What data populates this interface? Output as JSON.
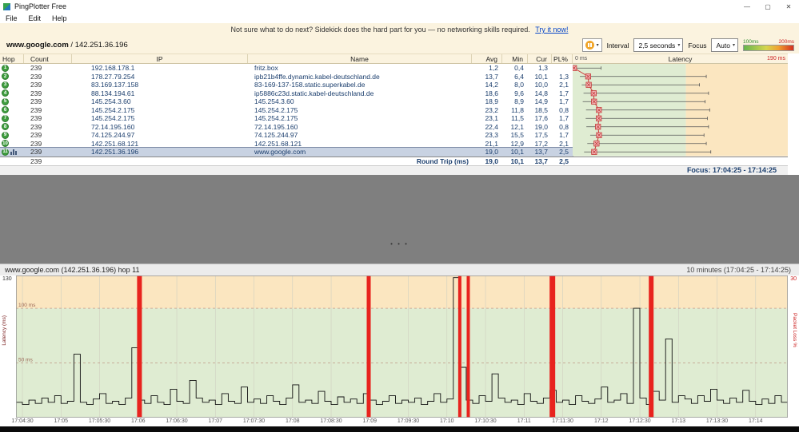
{
  "window": {
    "title": "PingPlotter Free"
  },
  "icons": {
    "minimize": "—",
    "maximize": "▢",
    "close": "✕",
    "dropdown": "▾",
    "splitter": "• • •"
  },
  "menu": {
    "items": [
      "File",
      "Edit",
      "Help"
    ]
  },
  "notice": {
    "text": "Not sure what to do next? Sidekick does the hard part for you — no networking skills required.",
    "link": "Try it now!"
  },
  "target": {
    "host": "www.google.com",
    "separator": "/",
    "ip": "142.251.36.196"
  },
  "toolbar": {
    "interval_label": "Interval",
    "interval_value": "2,5 seconds",
    "focus_label": "Focus",
    "focus_value": "Auto",
    "legend_low": "100ms",
    "legend_high": "200ms"
  },
  "table": {
    "columns": [
      "Hop",
      "Count",
      "IP",
      "Name",
      "Avg",
      "Min",
      "Cur",
      "PL%"
    ],
    "latency_title": "Latency",
    "scale_min": "0 ms",
    "scale_max": "190 ms",
    "scale_max_ms": 190,
    "green_threshold_ms": 100,
    "rows": [
      {
        "hop": "1",
        "count": "239",
        "ip": "192.168.178.1",
        "name": "fritz.box",
        "avg": "1,2",
        "min": "0,4",
        "cur": "1,3",
        "pl": "",
        "selected": false,
        "g": {
          "min": 0.4,
          "avg": 1.2,
          "max": 25
        }
      },
      {
        "hop": "2",
        "count": "239",
        "ip": "178.27.79.254",
        "name": "ipb21b4ffe.dynamic.kabel-deutschland.de",
        "avg": "13,7",
        "min": "6,4",
        "cur": "10,1",
        "pl": "1,3",
        "selected": false,
        "g": {
          "min": 6.4,
          "avg": 13.7,
          "max": 118
        }
      },
      {
        "hop": "3",
        "count": "239",
        "ip": "83.169.137.158",
        "name": "83-169-137-158.static.superkabel.de",
        "avg": "14,2",
        "min": "8,0",
        "cur": "10,0",
        "pl": "2,1",
        "selected": false,
        "g": {
          "min": 8.0,
          "avg": 14.2,
          "max": 112
        }
      },
      {
        "hop": "4",
        "count": "239",
        "ip": "88.134.194.61",
        "name": "ip5886c23d.static.kabel-deutschland.de",
        "avg": "18,6",
        "min": "9,6",
        "cur": "14,8",
        "pl": "1,7",
        "selected": false,
        "g": {
          "min": 9.6,
          "avg": 18.6,
          "max": 120
        }
      },
      {
        "hop": "5",
        "count": "239",
        "ip": "145.254.3.60",
        "name": "145.254.3.60",
        "avg": "18,9",
        "min": "8,9",
        "cur": "14,9",
        "pl": "1,7",
        "selected": false,
        "g": {
          "min": 8.9,
          "avg": 18.9,
          "max": 117
        }
      },
      {
        "hop": "6",
        "count": "239",
        "ip": "145.254.2.175",
        "name": "145.254.2.175",
        "avg": "23,2",
        "min": "11,8",
        "cur": "18,5",
        "pl": "0,8",
        "selected": false,
        "g": {
          "min": 11.8,
          "avg": 23.2,
          "max": 121
        }
      },
      {
        "hop": "7",
        "count": "239",
        "ip": "145.254.2.175",
        "name": "145.254.2.175",
        "avg": "23,1",
        "min": "11,5",
        "cur": "17,6",
        "pl": "1,7",
        "selected": false,
        "g": {
          "min": 11.5,
          "avg": 23.1,
          "max": 119
        }
      },
      {
        "hop": "8",
        "count": "239",
        "ip": "72.14.195.160",
        "name": "72.14.195.160",
        "avg": "22,4",
        "min": "12,1",
        "cur": "19,0",
        "pl": "0,8",
        "selected": false,
        "g": {
          "min": 12.1,
          "avg": 22.4,
          "max": 120
        }
      },
      {
        "hop": "9",
        "count": "239",
        "ip": "74.125.244.97",
        "name": "74.125.244.97",
        "avg": "23,3",
        "min": "15,5",
        "cur": "17,5",
        "pl": "1,7",
        "selected": false,
        "g": {
          "min": 15.5,
          "avg": 23.3,
          "max": 116
        }
      },
      {
        "hop": "10",
        "count": "239",
        "ip": "142.251.68.121",
        "name": "142.251.68.121",
        "avg": "21,1",
        "min": "12,9",
        "cur": "17,2",
        "pl": "2,1",
        "selected": false,
        "g": {
          "min": 12.9,
          "avg": 21.1,
          "max": 118
        }
      },
      {
        "hop": "11",
        "count": "239",
        "ip": "142.251.36.196",
        "name": "www.google.com",
        "avg": "19,0",
        "min": "10,1",
        "cur": "13,7",
        "pl": "2,5",
        "selected": true,
        "g": {
          "min": 10.1,
          "avg": 19.0,
          "max": 122
        }
      }
    ],
    "summary": {
      "count": "239",
      "label": "Round Trip (ms)",
      "avg": "19,0",
      "min": "10,1",
      "cur": "13,7",
      "pl": "2,5"
    },
    "focus": "Focus: 17:04:25 - 17:14:25"
  },
  "timeline": {
    "title": "www.google.com (142.251.36.196) hop 11",
    "range": "10 minutes (17:04:25 - 17:14:25)",
    "y_max_left": "130",
    "y_max_right": "30",
    "left_axis": "Latency (ms)",
    "right_axis": "Packet Loss %",
    "gridlines": [
      {
        "value": 100,
        "label": "100 ms"
      },
      {
        "value": 50,
        "label": "50 ms"
      }
    ],
    "x_ticks": [
      "17:04:30",
      "17:05",
      "17:05:30",
      "17:06",
      "17:06:30",
      "17:07",
      "17:07:30",
      "17:08",
      "17:08:30",
      "17:09",
      "17:09:30",
      "17:10",
      "17:10:30",
      "17:11",
      "17:11:30",
      "17:12",
      "17:12:30",
      "17:13",
      "17:13:30",
      "17:14"
    ],
    "chart": {
      "type": "line",
      "y_range": [
        0,
        130
      ],
      "sample_seconds": 5,
      "duration_seconds": 600,
      "threshold_green_max_ms": 100,
      "latency_ms": [
        14,
        12,
        16,
        13,
        18,
        14,
        20,
        13,
        15,
        58,
        14,
        12,
        17,
        22,
        13,
        15,
        12,
        18,
        64,
        16,
        13,
        20,
        14,
        12,
        26,
        15,
        13,
        34,
        18,
        14,
        16,
        12,
        22,
        15,
        13,
        28,
        14,
        17,
        13,
        20,
        15,
        12,
        18,
        30,
        14,
        16,
        13,
        24,
        15,
        12,
        19,
        14,
        17,
        13,
        22,
        16,
        12,
        15,
        20,
        13,
        16,
        14,
        18,
        12,
        15,
        22,
        14,
        17,
        128,
        46,
        16,
        13,
        20,
        15,
        40,
        18,
        14,
        16,
        12,
        22,
        15,
        13,
        18,
        25,
        14,
        16,
        12,
        20,
        15,
        13,
        17,
        28,
        14,
        16,
        22,
        13,
        100,
        18,
        12,
        24,
        16,
        72,
        14,
        20,
        17,
        13,
        20,
        15,
        26,
        16,
        13,
        18,
        14,
        25,
        15,
        12,
        17,
        13,
        20,
        14
      ],
      "loss_events": [
        {
          "f": 0.16,
          "w": 6
        },
        {
          "f": 0.457,
          "w": 5
        },
        {
          "f": 0.575,
          "w": 4
        },
        {
          "f": 0.586,
          "w": 4
        },
        {
          "f": 0.695,
          "w": 7
        },
        {
          "f": 0.823,
          "w": 6
        }
      ]
    }
  },
  "colors": {
    "green_band": "#dfecd2",
    "orange_band": "#fbe6c0",
    "loss_red": "#e8231e",
    "route_red": "#cc3333",
    "selection": "#c8d2e2",
    "accent_navy": "#1c3f6e"
  }
}
